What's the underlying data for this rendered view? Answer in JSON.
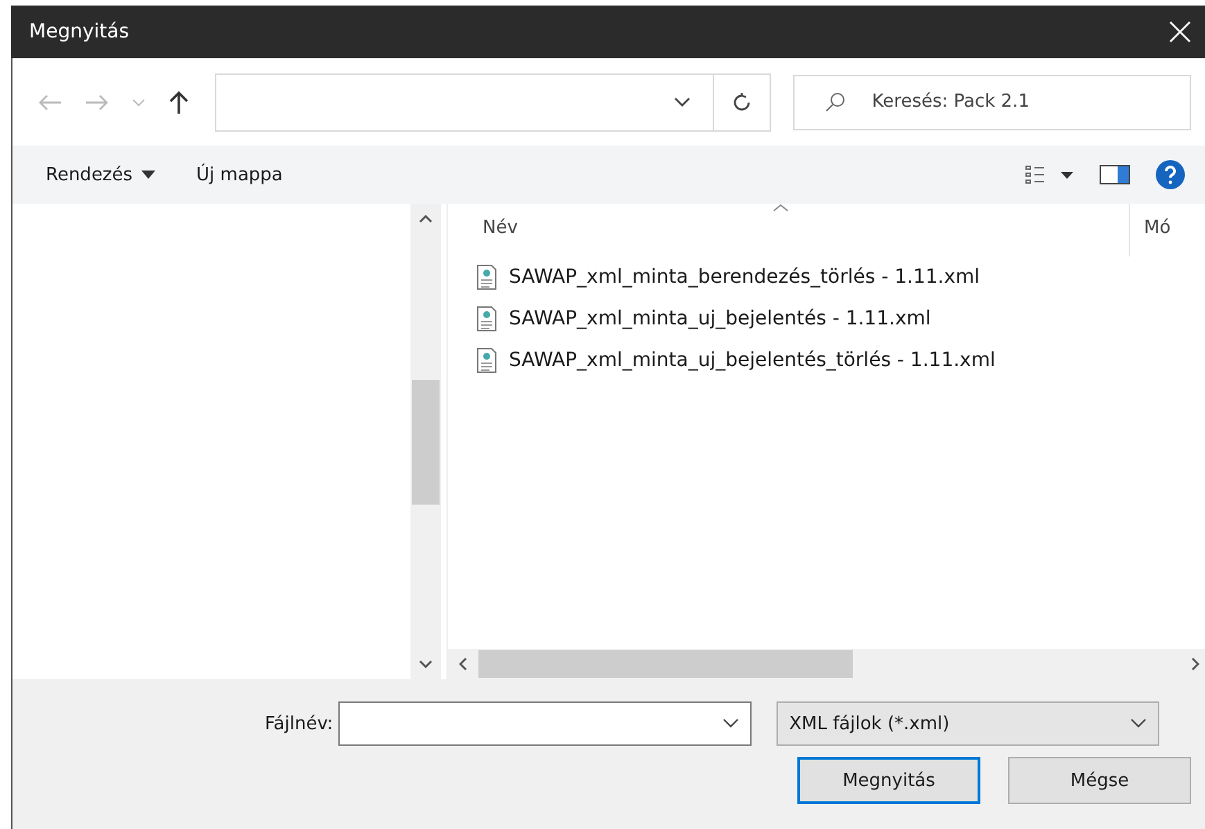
{
  "window": {
    "title": "Megnyitás"
  },
  "search": {
    "placeholder": "Keresés: Pack 2.1"
  },
  "toolbar": {
    "organize": "Rendezés",
    "new_folder": "Új mappa"
  },
  "columns": [
    "Név",
    "Mó"
  ],
  "files": [
    {
      "name": "SAWAP_xml_minta_berendezés_törlés - 1.11.xml",
      "selected": false
    },
    {
      "name": "SAWAP_xml_minta_uj_bejelentés - 1.11.xml",
      "selected": false
    },
    {
      "name": "SAWAP_xml_minta_uj_bejelentés_törlés - 1.11.xml",
      "selected": false
    }
  ],
  "filename": {
    "label": "Fájlnév:"
  },
  "filter": {
    "value": "XML fájlok (*.xml)"
  },
  "buttons": [
    {
      "label": "Megnyitás",
      "default": true
    },
    {
      "label": "Mégse",
      "default": false
    }
  ]
}
